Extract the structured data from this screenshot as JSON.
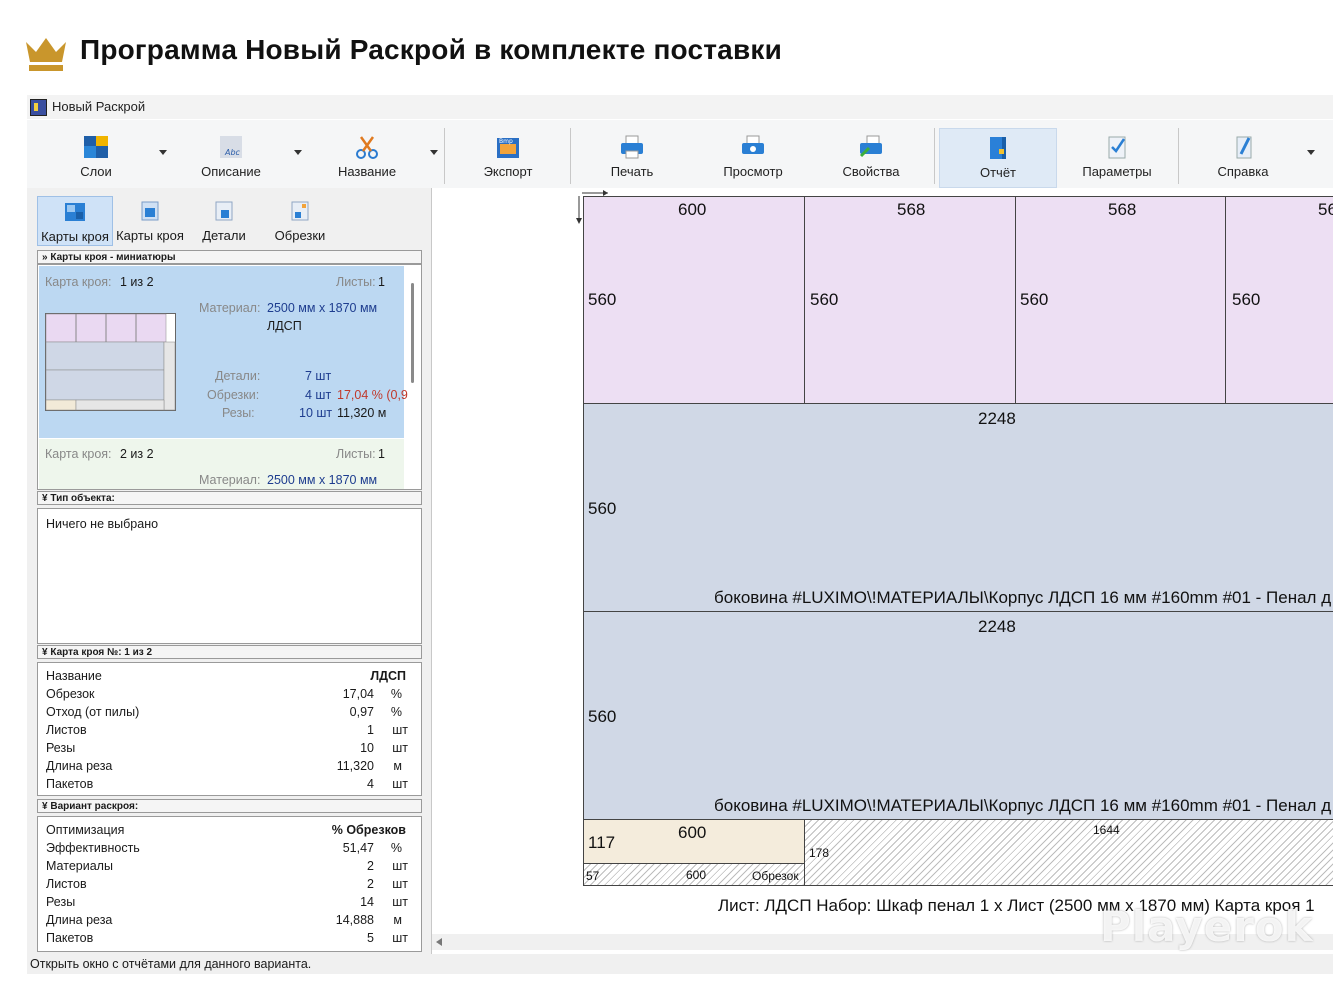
{
  "banner": {
    "title": "Программа Новый Раскрой в комплекте поставки"
  },
  "window": {
    "title": "Новый Раскрой"
  },
  "toolbar": {
    "buttons": [
      {
        "label": "Слои",
        "icon": "layers-icon"
      },
      {
        "label": "Описание",
        "icon": "description-icon"
      },
      {
        "label": "Название",
        "icon": "scissors-icon"
      },
      {
        "label": "Экспорт",
        "icon": "export-bmp-icon"
      },
      {
        "label": "Печать",
        "icon": "printer-icon"
      },
      {
        "label": "Просмотр",
        "icon": "print-preview-icon"
      },
      {
        "label": "Свойства",
        "icon": "printer-properties-icon"
      },
      {
        "label": "Отчёт",
        "icon": "report-icon"
      },
      {
        "label": "Параметры",
        "icon": "parameters-icon"
      },
      {
        "label": "Справка",
        "icon": "help-icon"
      }
    ]
  },
  "subtabs": [
    {
      "label": "Карты кроя",
      "icon": "cutting-maps-icon"
    },
    {
      "label": "Карты кроя",
      "icon": "cutting-maps-alt-icon"
    },
    {
      "label": "Детали",
      "icon": "details-icon"
    },
    {
      "label": "Обрезки",
      "icon": "offcuts-icon"
    }
  ],
  "thumbnails": {
    "header": "Карты кроя - миниатюры",
    "card1": {
      "map_label": "Карта кроя:",
      "map_value": "1 из 2",
      "sheets_label": "Листы:",
      "sheets_value": "1",
      "material_label": "Материал:",
      "material_value": "2500 мм x 1870 мм",
      "material_name": "ЛДСП",
      "details_label": "Детали:",
      "details_value": "7 шт",
      "offcuts_label": "Обрезки:",
      "offcuts_value": "4 шт",
      "offcuts_pct": "17,04 % (0,9",
      "cuts_label": "Резы:",
      "cuts_value": "10 шт",
      "cuts_len": "11,320 м"
    },
    "card2": {
      "map_label": "Карта кроя:",
      "map_value": "2 из 2",
      "sheets_label": "Листы:",
      "sheets_value": "1",
      "material_label": "Материал:",
      "material_value": "2500 мм x 1870 мм"
    }
  },
  "object_type": {
    "header": "Тип объекта:",
    "text": "Ничего не выбрано"
  },
  "map_info": {
    "header": "Карта кроя №: 1 из 2",
    "rows": [
      {
        "k": "Название",
        "v": "ЛДСП",
        "u": ""
      },
      {
        "k": "Обрезок",
        "v": "17,04",
        "u": "%"
      },
      {
        "k": "Отход (от пилы)",
        "v": "0,97",
        "u": "%"
      },
      {
        "k": "Листов",
        "v": "1",
        "u": "шт"
      },
      {
        "k": "Резы",
        "v": "10",
        "u": "шт"
      },
      {
        "k": "Длина реза",
        "v": "11,320",
        "u": "м"
      },
      {
        "k": "Пакетов",
        "v": "4",
        "u": "шт"
      }
    ]
  },
  "variant": {
    "header": "Вариант раскроя:",
    "rows": [
      {
        "k": "Оптимизация",
        "v": "% Обрезков",
        "u": ""
      },
      {
        "k": "Эффективность",
        "v": "51,47",
        "u": "%"
      },
      {
        "k": "Материалы",
        "v": "2",
        "u": "шт"
      },
      {
        "k": "Листов",
        "v": "2",
        "u": "шт"
      },
      {
        "k": "Резы",
        "v": "14",
        "u": "шт"
      },
      {
        "k": "Длина реза",
        "v": "14,888",
        "u": "м"
      },
      {
        "k": "Пакетов",
        "v": "5",
        "u": "шт"
      }
    ]
  },
  "canvas": {
    "top_parts": [
      {
        "w": "600",
        "h": "560"
      },
      {
        "w": "568",
        "h": "560"
      },
      {
        "w": "568",
        "h": "560"
      },
      {
        "w": "56",
        "h": "560"
      }
    ],
    "long_parts": [
      {
        "w": "2248",
        "h": "560",
        "label": "боковина #LUXIMO\\!МАТЕРИАЛЫ\\Корпус ЛДСП 16 мм #160mm #01 -  Пенал д"
      },
      {
        "w": "2248",
        "h": "560",
        "label": "боковина #LUXIMO\\!МАТЕРИАЛЫ\\Корпус ЛДСП 16 мм #160mm #01 -  Пенал д"
      }
    ],
    "small_part": {
      "w": "600",
      "h": "117"
    },
    "offcut": {
      "w": "600",
      "h": "57",
      "label": "Обрезок"
    },
    "waste": {
      "w": "1644",
      "h": "178"
    },
    "footer": "Лист: ЛДСП  Набор: Шкаф пенал  1 x Лист (2500 мм x 1870 мм)  Карта кроя 1"
  },
  "status": "Открыть окно с отчётами для данного варианта.",
  "watermark": "Playerok",
  "colors": {
    "part_purple": "#eddff3",
    "part_blue": "#d0d8e6",
    "part_beige": "#f4ecdc",
    "selected": "#bcd8f2",
    "accent": "#1e3d8f"
  }
}
